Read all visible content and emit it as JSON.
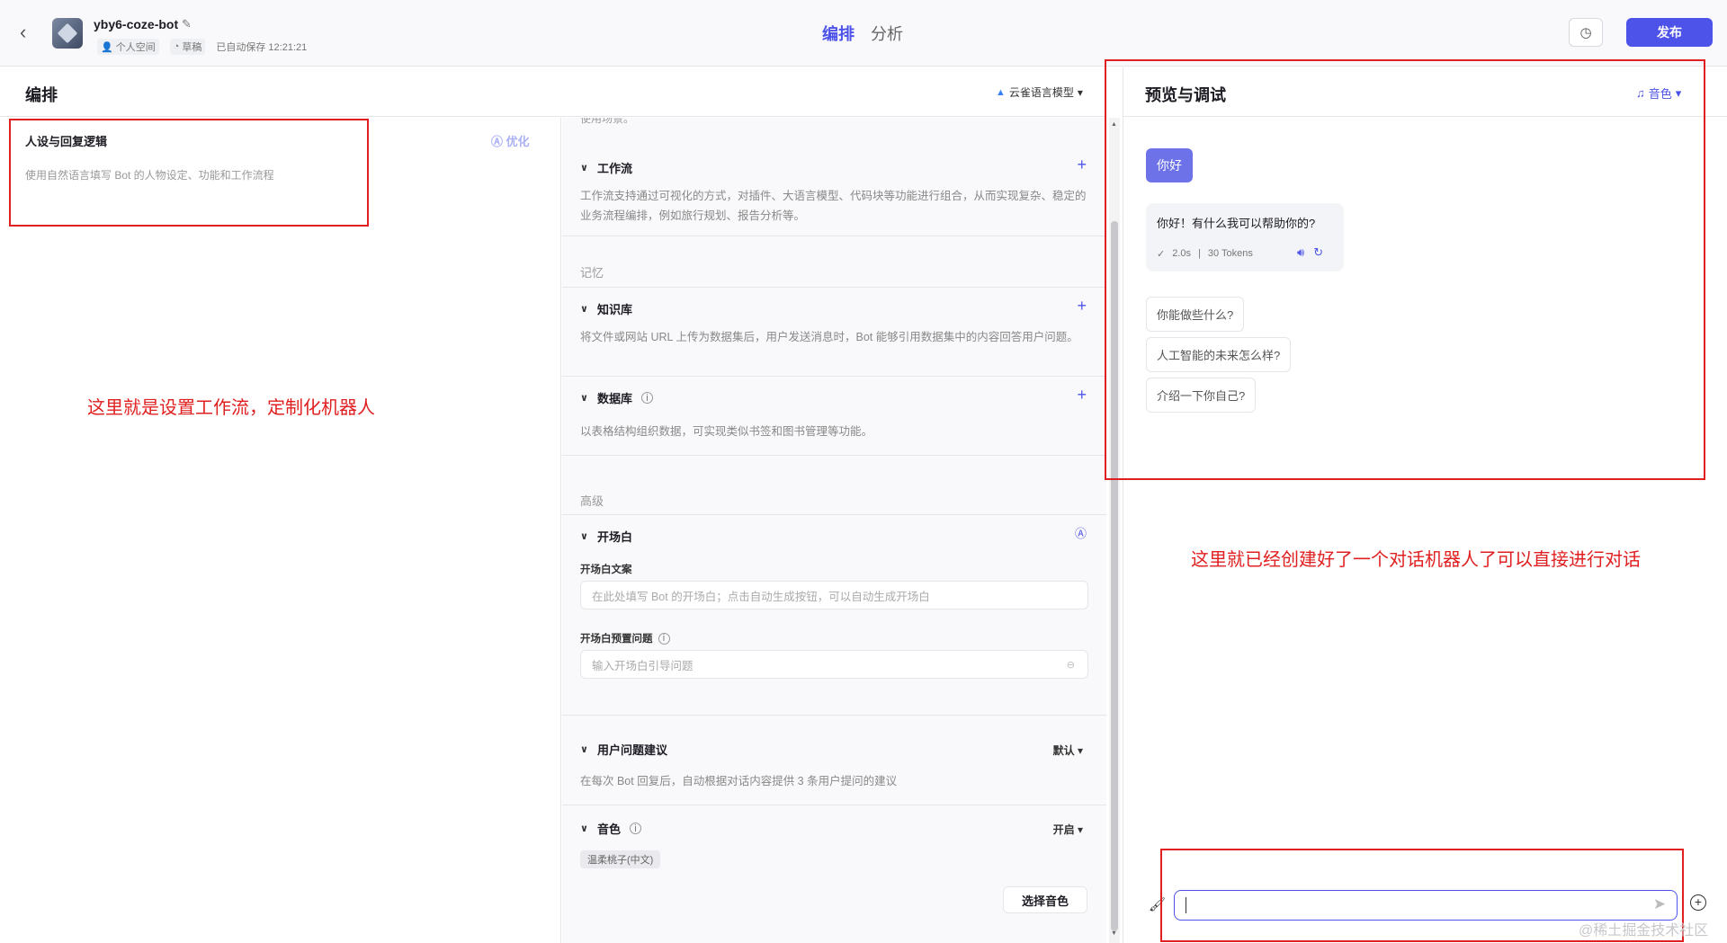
{
  "header": {
    "bot_name": "yby6-coze-bot",
    "space": "个人空间",
    "status": "草稿",
    "saved": "已自动保存 12:21:21",
    "tabs": [
      "编排",
      "分析"
    ],
    "publish_label": "发布"
  },
  "left": {
    "title": "编排",
    "model": "云雀语言模型",
    "persona_title": "人设与回复逻辑",
    "optimize_label": "优化",
    "persona_placeholder": "使用自然语言填写 Bot 的人物设定、功能和工作流程",
    "annotation": "这里就是设置工作流，定制化机器人"
  },
  "skills": {
    "cut_text": "使用场景。",
    "workflow": {
      "title": "工作流",
      "desc": "工作流支持通过可视化的方式，对插件、大语言模型、代码块等功能进行组合，从而实现复杂、稳定的业务流程编排，例如旅行规划、报告分析等。"
    },
    "memory_label": "记忆",
    "knowledge": {
      "title": "知识库",
      "desc": "将文件或网站 URL 上传为数据集后，用户发送消息时，Bot 能够引用数据集中的内容回答用户问题。"
    },
    "database": {
      "title": "数据库",
      "desc": "以表格结构组织数据，可实现类似书签和图书管理等功能。"
    },
    "advanced_label": "高级",
    "opening": {
      "title": "开场白",
      "text_label": "开场白文案",
      "text_placeholder": "在此处填写 Bot 的开场白；点击自动生成按钮，可以自动生成开场白",
      "question_label": "开场白预置问题",
      "question_placeholder": "输入开场白引导问题"
    },
    "suggestion": {
      "title": "用户问题建议",
      "value": "默认",
      "desc": "在每次 Bot 回复后，自动根据对话内容提供 3 条用户提问的建议"
    },
    "voice": {
      "title": "音色",
      "value": "开启",
      "tag": "温柔桃子(中文)",
      "button": "选择音色"
    }
  },
  "preview": {
    "title": "预览与调试",
    "voice_label": "音色",
    "user_msg": "你好",
    "bot_msg": "你好！有什么我可以帮助你的?",
    "bot_time": "2.0s",
    "bot_tokens": "30 Tokens",
    "suggestions": [
      "你能做些什么?",
      "人工智能的未来怎么样?",
      "介绍一下你自己?"
    ],
    "annotation": "这里就已经创建好了一个对话机器人了可以直接进行对话"
  },
  "watermark": "@稀土掘金技术社区",
  "colors": {
    "accent": "#4d53e8",
    "annotation": "#e02020"
  }
}
